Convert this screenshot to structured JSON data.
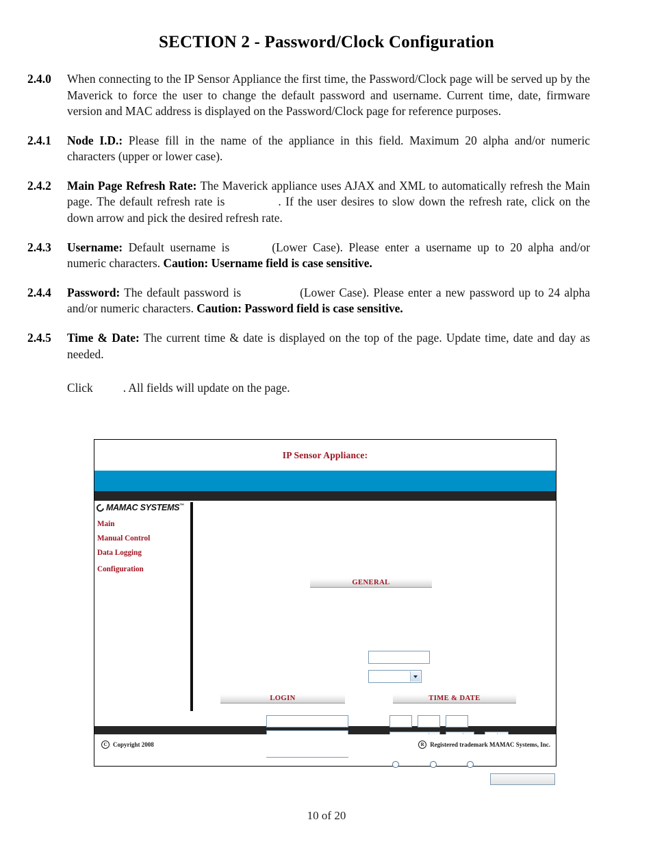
{
  "document": {
    "title": "SECTION 2 - Password/Clock Configuration",
    "page_number": "10 of 20",
    "paragraphs": [
      {
        "number": "2.4.0",
        "lead": "",
        "text_before": "When connecting to the IP Sensor Appliance the first time, the Password/Clock page will be served up by the Maverick to force the user to change the default password and username. Current time, date, firmware version and MAC address is displayed on the Password/Clock page for reference purposes.",
        "text_after": "",
        "caution": ""
      },
      {
        "number": "2.4.1",
        "lead": "Node I.D.:",
        "text_before": "Please fill in the name of the appliance in this field. Maximum 20 alpha and/or numeric characters (upper or lower case).",
        "text_after": "",
        "caution": ""
      },
      {
        "number": "2.4.2",
        "lead": "Main Page Refresh Rate:",
        "text_before": "The Maverick appliance uses AJAX and XML to automatically refresh the Main page. The default refresh rate is",
        "text_after": ". If the user desires to slow down the refresh rate, click on the down arrow and pick the desired refresh rate.",
        "caution": ""
      },
      {
        "number": "2.4.3",
        "lead": "Username:",
        "text_before": "Default username is",
        "text_after": "(Lower Case). Please enter a username up to 20 alpha and/or numeric characters.",
        "caution": "Caution: Username field is case sensitive."
      },
      {
        "number": "2.4.4",
        "lead": "Password:",
        "text_before": "The default password is",
        "text_after": "(Lower Case). Please enter a new password up to 24 alpha and/or numeric characters.",
        "caution": "Caution: Password field is case sensitive."
      },
      {
        "number": "2.4.5",
        "lead": "Time & Date:",
        "text_before": "The current time & date is displayed on the top of the page. Update time, date and day as needed.",
        "text_after": "",
        "caution": ""
      }
    ],
    "click_line": {
      "before": "Click",
      "after": ". All fields will update on the page."
    }
  },
  "appliance": {
    "header_title": "IP Sensor Appliance:",
    "logo": {
      "text": "MAMAC SYSTEMS",
      "trademark": "™"
    },
    "nav": [
      {
        "label": "Main"
      },
      {
        "label": "Manual Control"
      },
      {
        "label": "Data Logging"
      },
      {
        "label": "Configuration"
      }
    ],
    "sections": {
      "general": "GENERAL",
      "login": "LOGIN",
      "time_date": "TIME & DATE"
    },
    "fields": {
      "general_node_id": "",
      "general_refresh_rate": "",
      "login_field_1": "",
      "login_field_2": "",
      "login_field_3": "",
      "time_hour": "",
      "time_minute": "",
      "time_second": "",
      "date_dropdown_1": "",
      "date_dropdown_2": "",
      "date_dropdown_3": "",
      "submit_button_label": ""
    },
    "footer": {
      "copyright_symbol": "C",
      "copyright_text": "Copyright 2008",
      "registered_symbol": "R",
      "registered_text": "Registered trademark MAMAC Systems, Inc."
    },
    "colors": {
      "accent_red": "#9c1420",
      "banner_cyan": "#0091c8",
      "banner_dark": "#262626",
      "field_border": "#7b9bb5"
    }
  }
}
